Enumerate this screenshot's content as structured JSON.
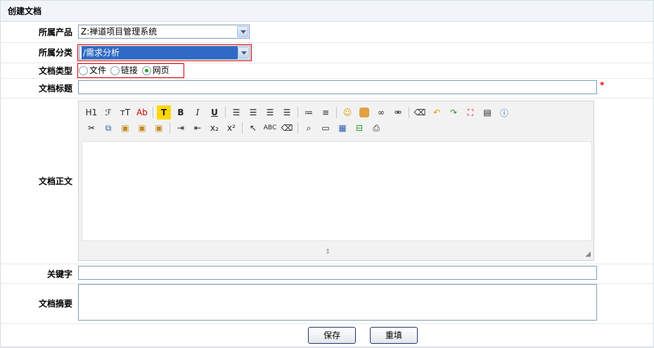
{
  "header": {
    "title": "创建文档"
  },
  "form": {
    "product": {
      "label": "所属产品",
      "value": "Z:禅道项目管理系统"
    },
    "module": {
      "label": "所属分类",
      "value": "/需求分析"
    },
    "type": {
      "label": "文档类型",
      "options": [
        {
          "label": "文件",
          "checked": false
        },
        {
          "label": "链接",
          "checked": false
        },
        {
          "label": "网页",
          "checked": true
        }
      ]
    },
    "title": {
      "label": "文档标题",
      "value": "",
      "required_mark": "*"
    },
    "content": {
      "label": "文档正文"
    },
    "keywords": {
      "label": "关键字",
      "value": ""
    },
    "digest": {
      "label": "文档摘要",
      "value": ""
    }
  },
  "toolbar": {
    "row1": [
      "heading-icon",
      "font-family-icon",
      "font-size-icon",
      "text-color-icon",
      "highlight-icon",
      "bold-icon",
      "italic-icon",
      "underline-icon",
      "align-left-icon",
      "align-center-icon",
      "align-right-icon",
      "justify-icon",
      "ordered-list-icon",
      "unordered-list-icon",
      "emoticon-icon",
      "image-icon",
      "link-icon",
      "unlink-icon",
      "clear-format-icon",
      "undo-icon",
      "redo-icon",
      "fullscreen-icon",
      "paste-word-icon",
      "help-icon"
    ],
    "row2": [
      "cut-icon",
      "copy-icon",
      "paste-icon",
      "paste-text-icon",
      "paste-word2-icon",
      "indent-icon",
      "outdent-icon",
      "subscript-icon",
      "superscript-icon",
      "select-all-icon",
      "spellcheck-icon",
      "eraser-icon",
      "preview-icon",
      "flash-icon",
      "table-icon",
      "horizontal-rule-icon",
      "print-icon"
    ],
    "labels": {
      "heading": "H1",
      "font_family": "ℱ",
      "font_size": "ᴛT",
      "text_color": "Ab",
      "highlight": "T",
      "bold": "B",
      "italic": "I",
      "underline": "U",
      "subscript": "x₂",
      "superscript": "x²",
      "spellcheck": "ABC"
    }
  },
  "actions": {
    "save": "保存",
    "reset": "重填"
  },
  "colors": {
    "header_bg": "#f1f4f8",
    "border_red": "#d60000",
    "button_border": "#23356a"
  }
}
